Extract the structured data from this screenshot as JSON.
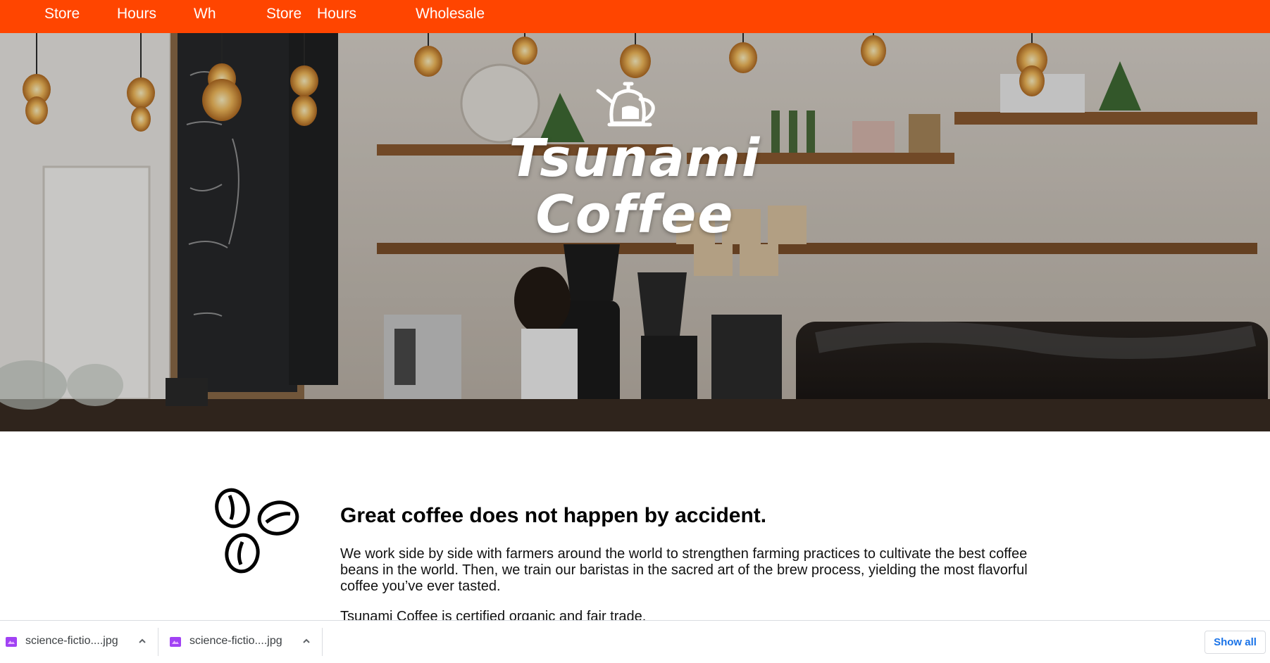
{
  "nav": {
    "items": [
      {
        "label": "Store"
      },
      {
        "label": "Hours"
      },
      {
        "label": "Wh"
      },
      {
        "label": "Store"
      },
      {
        "label": "Hours"
      },
      {
        "label": "Wholesale"
      }
    ]
  },
  "hero": {
    "brand_line1": "Tsunami",
    "brand_line2": "Coffee",
    "icon": "kettle-icon"
  },
  "content": {
    "icon": "coffee-beans-icon",
    "headline": "Great coffee does not happen by accident.",
    "paragraph": "We work side by side with farmers around the world to strengthen farming practices to cultivate the best coffee beans in the world. Then, we train our baristas in the sacred art of the brew process, yielding the most flavorful coffee you’ve ever tasted.",
    "paragraph2": "Tsunami Coffee is certified organic and fair trade."
  },
  "downloads": {
    "items": [
      {
        "name": "science-fictio....jpg",
        "icon": "image-file-icon"
      },
      {
        "name": "science-fictio....jpg",
        "icon": "image-file-icon"
      }
    ],
    "show_all_label": "Show all"
  },
  "colors": {
    "nav_bg": "#ff4500",
    "show_all_text": "#1a73e8"
  }
}
